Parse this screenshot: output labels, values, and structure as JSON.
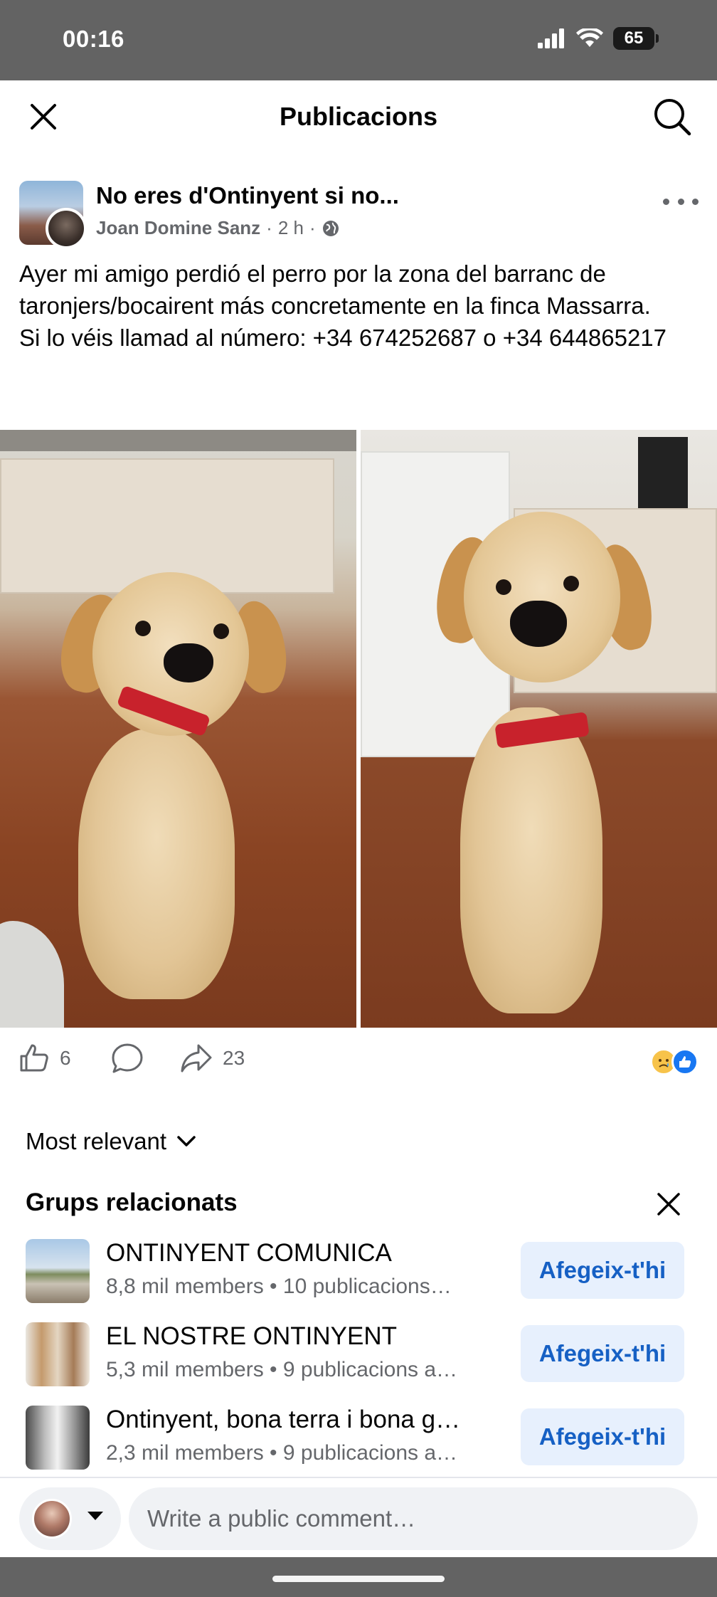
{
  "status_bar": {
    "time": "00:16",
    "battery": "65"
  },
  "header": {
    "title": "Publicacions"
  },
  "post": {
    "group_name": "No eres d'Ontinyent si no...",
    "author": "Joan Domine Sanz",
    "time": "2 h",
    "separator": "·",
    "text": "Ayer mi amigo perdió el perro por la zona del barranc de taronjers/bocairent más concretamente en la finca Massarra.\nSi lo véis llamad al número: +34 674252687 o +34 644865217"
  },
  "actions": {
    "like_count": "6",
    "share_count": "23"
  },
  "sort": {
    "label": "Most relevant"
  },
  "related": {
    "title": "Grups relacionats",
    "groups": [
      {
        "name": "ONTINYENT COMUNICA",
        "meta": "8,8 mil members • 10 publicacions…",
        "join_label": "Afegeix-t'hi"
      },
      {
        "name": "EL NOSTRE ONTINYENT",
        "meta": "5,3 mil members • 9 publicacions a…",
        "join_label": "Afegeix-t'hi"
      },
      {
        "name": "Ontinyent, bona terra i bona g…",
        "meta": "2,3 mil members • 9 publicacions a…",
        "join_label": "Afegeix-t'hi"
      }
    ]
  },
  "composer": {
    "placeholder": "Write a public comment…"
  },
  "colors": {
    "accent": "#1877f2",
    "join_bg": "#e7f0fd",
    "join_text": "#1660c4",
    "secondary_text": "#65676b",
    "status_bar": "#636363"
  }
}
